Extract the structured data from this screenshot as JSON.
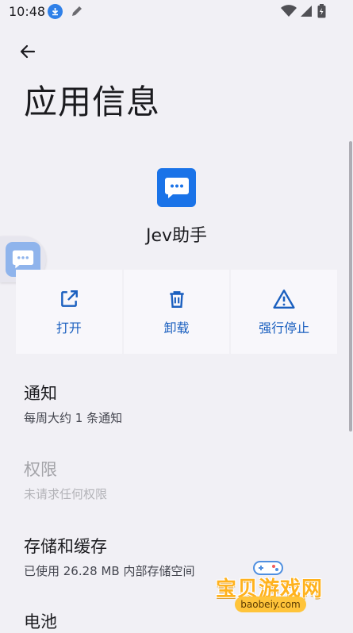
{
  "status_bar": {
    "time": "10:48"
  },
  "header": {
    "title": "应用信息"
  },
  "app": {
    "name": "Jev助手"
  },
  "actions": [
    {
      "label": "打开",
      "icon": "open-external-icon"
    },
    {
      "label": "卸载",
      "icon": "trash-icon"
    },
    {
      "label": "强行停止",
      "icon": "warning-icon"
    }
  ],
  "settings": [
    {
      "title": "通知",
      "subtitle": "每周大约 1 条通知",
      "enabled": true
    },
    {
      "title": "权限",
      "subtitle": "未请求任何权限",
      "enabled": false
    },
    {
      "title": "存储和缓存",
      "subtitle": "已使用 26.28 MB 内部存储空间",
      "enabled": true
    },
    {
      "title": "电池",
      "subtitle": "",
      "enabled": true
    }
  ],
  "watermark": {
    "text": "宝贝游戏网",
    "url": "baobeiy.com"
  },
  "colors": {
    "accent": "#1a5fbf",
    "app_icon": "#1a73e8",
    "background": "#f1f0f5"
  }
}
